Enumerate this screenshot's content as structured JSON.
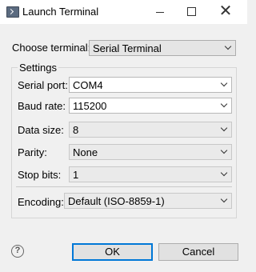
{
  "window": {
    "title": "Launch Terminal",
    "close_glyph": "✕"
  },
  "terminal": {
    "label": "Choose terminal:",
    "value": "Serial Terminal"
  },
  "settings": {
    "title": "Settings",
    "fields": [
      {
        "label": "Serial port:",
        "value": "COM4"
      },
      {
        "label": "Baud rate:",
        "value": "115200"
      },
      {
        "label": "Data size:",
        "value": "8"
      },
      {
        "label": "Parity:",
        "value": "None"
      },
      {
        "label": "Stop bits:",
        "value": "1"
      }
    ],
    "encoding": {
      "label": "Encoding:",
      "value": "Default (ISO-8859-1)"
    }
  },
  "buttons": {
    "help_glyph": "?",
    "ok": "OK",
    "cancel": "Cancel"
  }
}
